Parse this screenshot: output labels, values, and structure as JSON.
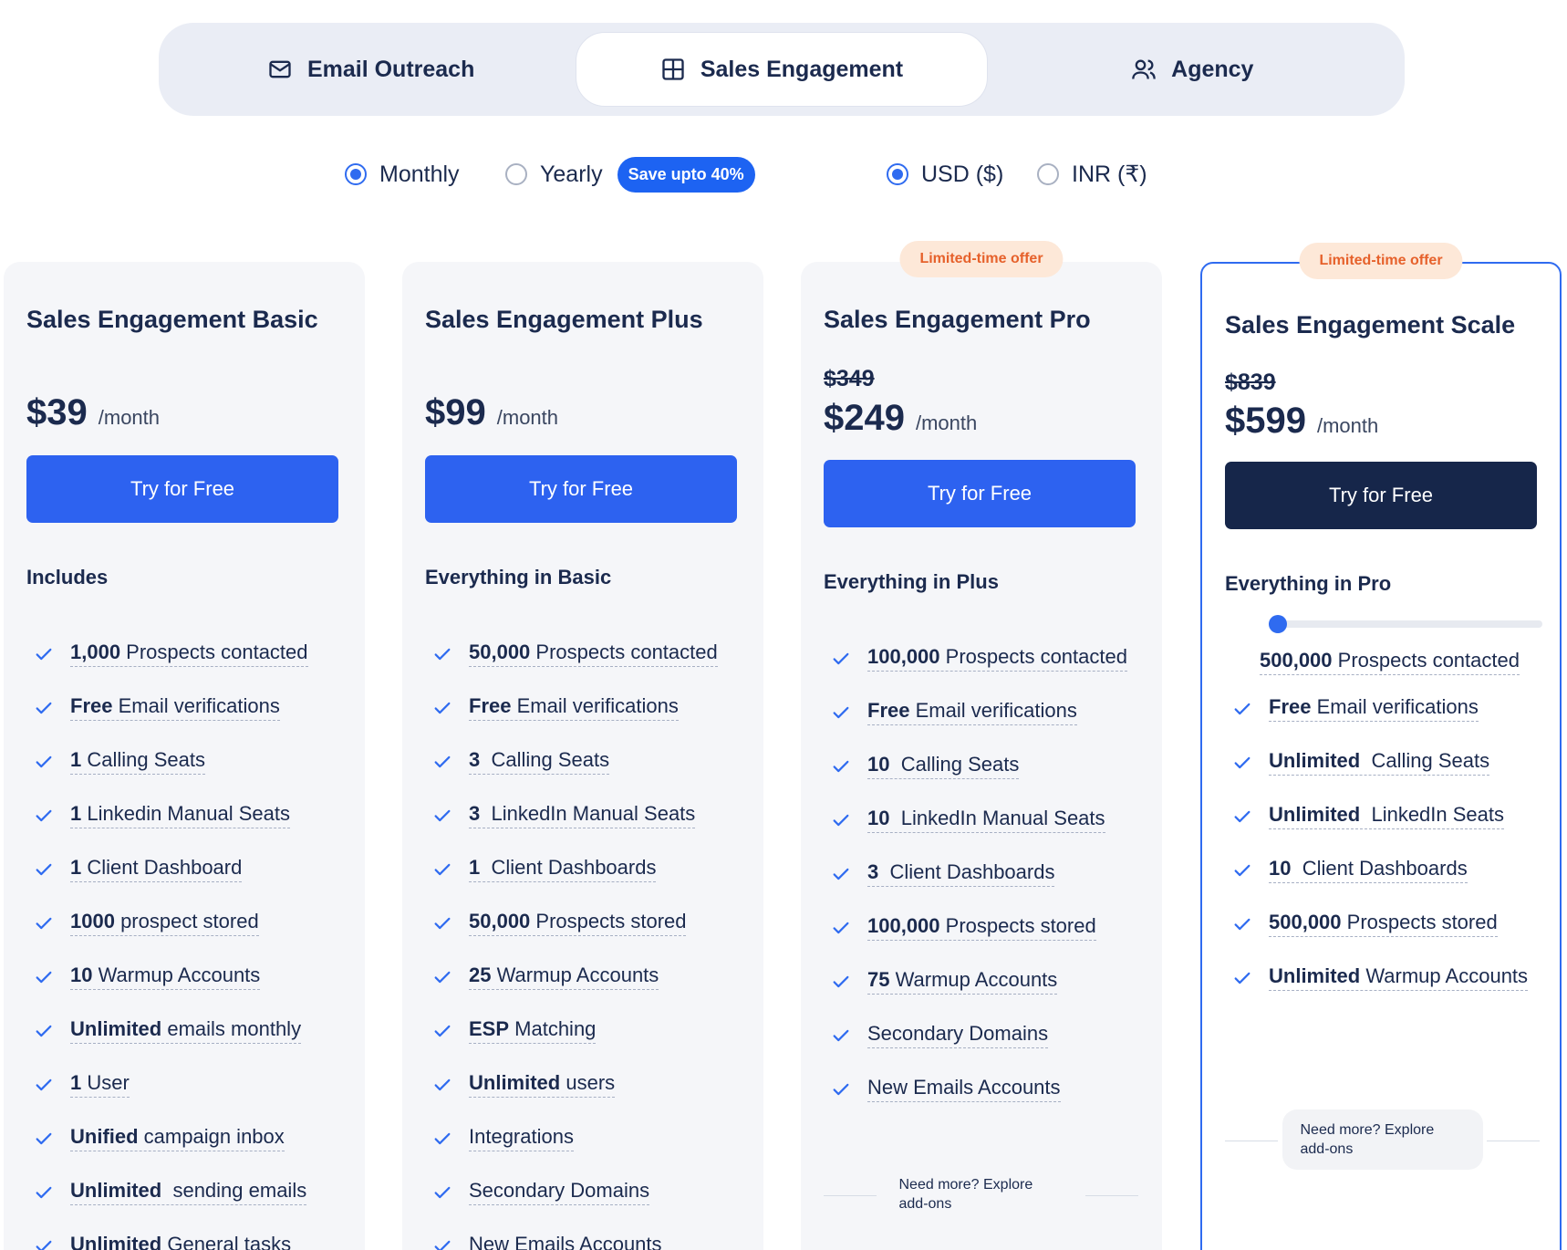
{
  "tabs": [
    {
      "label": "Email Outreach",
      "icon": "mail-icon",
      "active": false
    },
    {
      "label": "Sales Engagement",
      "icon": "grid-icon",
      "active": true
    },
    {
      "label": "Agency",
      "icon": "users-icon",
      "active": false
    }
  ],
  "billing": {
    "monthly_label": "Monthly",
    "yearly_label": "Yearly",
    "save_badge": "Save upto 40%",
    "selected": "Monthly"
  },
  "currency": {
    "usd_label": "USD ($)",
    "inr_label": "INR (₹)",
    "selected": "USD ($)"
  },
  "colors": {
    "accent": "#2d62f0",
    "dark_button": "#16264a",
    "text": "#1b2a4e",
    "offer_bg": "#fde8d8",
    "offer_text": "#e6612b",
    "card_bg": "#f5f6f9"
  },
  "plans": [
    {
      "title": "Sales Engagement Basic",
      "price": "$39",
      "per": "/month",
      "cta": "Try for Free",
      "includes": "Includes",
      "features": [
        {
          "bold": "1,000",
          "text": " Prospects contacted"
        },
        {
          "bold": "Free",
          "text": " Email verifications"
        },
        {
          "bold": "1",
          "text": " Calling Seats"
        },
        {
          "bold": "1",
          "text": " Linkedin Manual Seats"
        },
        {
          "bold": "1",
          "text": " Client Dashboard"
        },
        {
          "bold": "1000",
          "text": " prospect stored"
        },
        {
          "bold": "10",
          "text": " Warmup Accounts"
        },
        {
          "bold": "Unlimited",
          "text": " emails monthly"
        },
        {
          "bold": "1",
          "text": " User"
        },
        {
          "bold": "Unified",
          "text": " campaign inbox"
        },
        {
          "bold": "Unlimited",
          "text": "  sending emails"
        },
        {
          "bold": "Unlimited",
          "text": " General tasks"
        }
      ]
    },
    {
      "title": "Sales Engagement Plus",
      "price": "$99",
      "per": "/month",
      "cta": "Try for Free",
      "includes": "Everything in Basic",
      "features": [
        {
          "bold": "50,000",
          "text": " Prospects contacted"
        },
        {
          "bold": "Free",
          "text": " Email verifications"
        },
        {
          "bold": "3",
          "text": "  Calling Seats"
        },
        {
          "bold": "3",
          "text": "  LinkedIn Manual Seats"
        },
        {
          "bold": "1",
          "text": "  Client Dashboards"
        },
        {
          "bold": "50,000",
          "text": " Prospects stored"
        },
        {
          "bold": "25",
          "text": " Warmup Accounts"
        },
        {
          "bold": "ESP",
          "text": " Matching"
        },
        {
          "bold": "Unlimited",
          "text": " users"
        },
        {
          "bold": "",
          "text": "Integrations"
        },
        {
          "bold": "",
          "text": "Secondary Domains"
        },
        {
          "bold": "",
          "text": "New Emails Accounts"
        }
      ]
    },
    {
      "title": "Sales Engagement Pro",
      "offer": "Limited-time offer",
      "old_price": "$349",
      "price": "$249",
      "per": "/month",
      "cta": "Try for Free",
      "includes": "Everything in Plus",
      "features": [
        {
          "bold": "100,000",
          "text": " Prospects contacted"
        },
        {
          "bold": "Free",
          "text": " Email verifications"
        },
        {
          "bold": "10",
          "text": "  Calling Seats"
        },
        {
          "bold": "10",
          "text": "  LinkedIn Manual Seats"
        },
        {
          "bold": "3",
          "text": "  Client Dashboards"
        },
        {
          "bold": "100,000",
          "text": " Prospects stored"
        },
        {
          "bold": "75",
          "text": " Warmup Accounts"
        },
        {
          "bold": "",
          "text": "Secondary Domains"
        },
        {
          "bold": "",
          "text": "New Emails Accounts"
        }
      ],
      "more": "Need more? Explore add-ons"
    },
    {
      "title": "Sales Engagement Scale",
      "offer": "Limited-time offer",
      "old_price": "$839",
      "price": "$599",
      "per": "/month",
      "cta": "Try for Free",
      "includes": "Everything in Pro",
      "slider": {
        "bold": "500,000",
        "text": " Prospects contacted",
        "level": 0
      },
      "features": [
        {
          "bold": "Free",
          "text": " Email verifications"
        },
        {
          "bold": "Unlimited",
          "text": "  Calling Seats"
        },
        {
          "bold": "Unlimited",
          "text": "  LinkedIn Seats"
        },
        {
          "bold": "10",
          "text": "  Client Dashboards"
        },
        {
          "bold": "500,000",
          "text": " Prospects stored"
        },
        {
          "bold": "Unlimited",
          "text": " Warmup Accounts"
        }
      ],
      "more": "Need more? Explore add-ons"
    }
  ]
}
